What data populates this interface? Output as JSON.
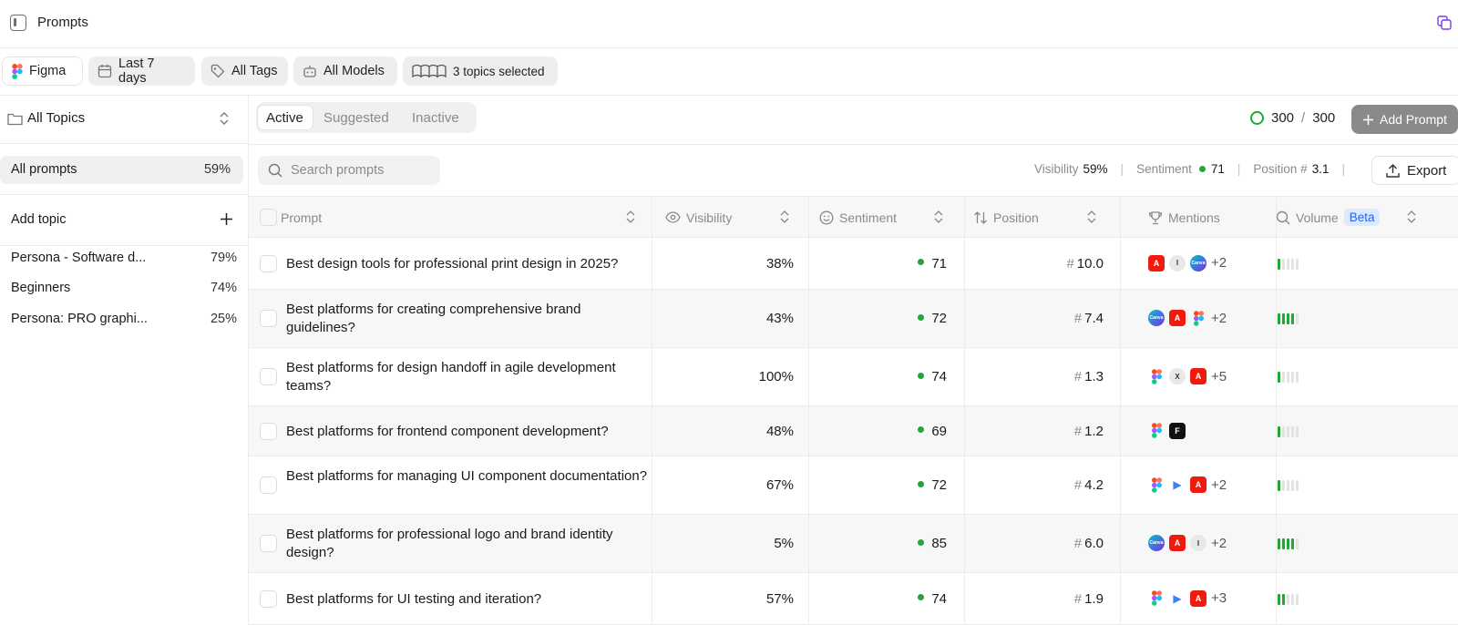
{
  "header": {
    "title": "Prompts"
  },
  "filters": {
    "brand": "Figma",
    "date_range": "Last 7 days",
    "tags": "All Tags",
    "models": "All Models",
    "topics": "3 topics selected"
  },
  "sidebar": {
    "topic_selector": "All Topics",
    "all_prompts": {
      "label": "All prompts",
      "pct": "59%"
    },
    "add_topic": "Add topic",
    "topics": [
      {
        "name": "Persona - Software d...",
        "pct": "79%"
      },
      {
        "name": "Beginners",
        "pct": "74%"
      },
      {
        "name": "Persona: PRO graphi...",
        "pct": "25%"
      }
    ]
  },
  "tabs": [
    {
      "label": "Active",
      "active": true
    },
    {
      "label": "Suggested",
      "active": false
    },
    {
      "label": "Inactive",
      "active": false
    }
  ],
  "quota": {
    "used": "300",
    "sep": "/",
    "total": "300"
  },
  "add_prompt_label": "Add Prompt",
  "search": {
    "placeholder": "Search prompts"
  },
  "summary": {
    "visibility_label": "Visibility",
    "visibility": "59%",
    "sentiment_label": "Sentiment",
    "sentiment": "71",
    "position_label": "Position #",
    "position": "3.1",
    "divider": "|"
  },
  "export_label": "Export",
  "columns": {
    "prompt": "Prompt",
    "visibility": "Visibility",
    "sentiment": "Sentiment",
    "position": "Position",
    "mentions": "Mentions",
    "volume": "Volume",
    "volume_badge": "Beta"
  },
  "rows": [
    {
      "prompt": "Best design tools for professional print design in 2025?",
      "visibility": "38%",
      "sentiment": "71",
      "position": "10.0",
      "mentions": [
        "adobe",
        "grey",
        "canva"
      ],
      "mentions_more": "+2",
      "volume": 0.2
    },
    {
      "prompt": "Best platforms for creating comprehensive brand guidelines?",
      "visibility": "43%",
      "sentiment": "72",
      "position": "7.4",
      "mentions": [
        "canva",
        "adobe",
        "figma"
      ],
      "mentions_more": "+2",
      "volume": 0.8
    },
    {
      "prompt": "Best platforms for design handoff in agile development teams?",
      "visibility": "100%",
      "sentiment": "74",
      "position": "1.3",
      "mentions": [
        "figma",
        "grey",
        "adobe"
      ],
      "mentions_more": "+5",
      "volume": 0.2
    },
    {
      "prompt": "Best platforms for frontend component development?",
      "visibility": "48%",
      "sentiment": "69",
      "position": "1.2",
      "mentions": [
        "figma",
        "framer"
      ],
      "mentions_more": "",
      "volume": 0.2
    },
    {
      "prompt": "Best platforms for managing UI component documentation?",
      "visibility": "67%",
      "sentiment": "72",
      "position": "4.2",
      "mentions": [
        "figma",
        "play",
        "adobe"
      ],
      "mentions_more": "+2",
      "volume": 0.2
    },
    {
      "prompt": "Best platforms for professional logo and brand identity design?",
      "visibility": "5%",
      "sentiment": "85",
      "position": "6.0",
      "mentions": [
        "canva",
        "adobe",
        "grey"
      ],
      "mentions_more": "+2",
      "volume": 0.8
    },
    {
      "prompt": "Best platforms for UI testing and iteration?",
      "visibility": "57%",
      "sentiment": "74",
      "position": "1.9",
      "mentions": [
        "figma",
        "play",
        "adobe"
      ],
      "mentions_more": "+3",
      "volume": 0.4
    }
  ],
  "logo_glyphs": {
    "adobe": "A",
    "grey": "I",
    "canva": "Canva",
    "framer": "F",
    "play": "▶"
  },
  "logo_glyphs_alt": {
    "row3_grey": "X"
  },
  "colors": {
    "accent_green": "#22a63a",
    "beta_blue": "#2563eb",
    "adobe_red": "#f01b0e"
  }
}
